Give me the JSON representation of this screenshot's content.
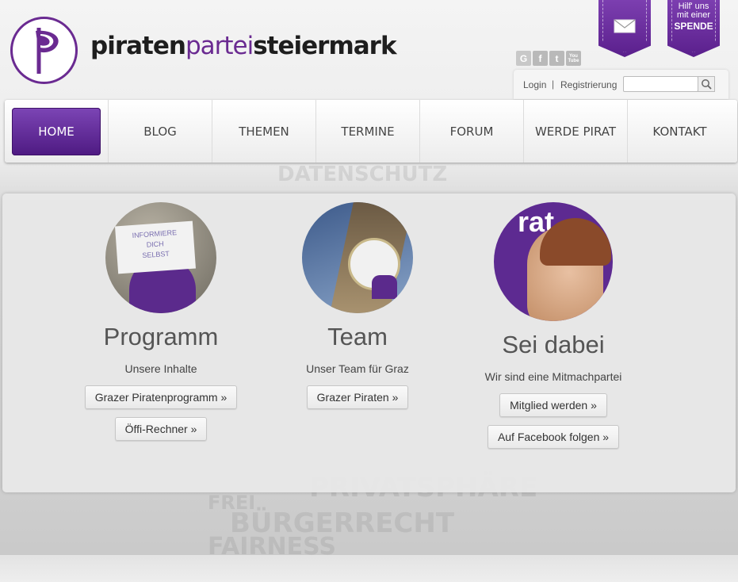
{
  "site": {
    "title_part1": "piraten",
    "title_part2": "partei",
    "title_part3": "steiermark"
  },
  "ribbons": {
    "mail_icon": "envelope-icon",
    "donate_line1": "Hilf' uns",
    "donate_line2": "mit einer",
    "donate_line3": "SPENDE"
  },
  "social": {
    "google": "G",
    "facebook": "f",
    "twitter": "t",
    "youtube": "You Tube"
  },
  "userbar": {
    "login": "Login",
    "separator": "|",
    "register": "Registrierung",
    "search_value": ""
  },
  "nav": {
    "items": [
      {
        "label": "HOME"
      },
      {
        "label": "BLOG"
      },
      {
        "label": "THEMEN"
      },
      {
        "label": "TERMINE"
      },
      {
        "label": "FORUM"
      },
      {
        "label": "WERDE PIRAT"
      },
      {
        "label": "KONTAKT"
      }
    ]
  },
  "columns": [
    {
      "photo_sign": [
        "INFORMIERE",
        "DICH",
        "SELBST"
      ],
      "title": "Programm",
      "subtitle": "Unsere Inhalte",
      "buttons": [
        "Grazer Piratenprogramm »",
        "Öffi-Rechner »"
      ]
    },
    {
      "title": "Team",
      "subtitle": "Unser Team für Graz",
      "buttons": [
        "Grazer Piraten »"
      ]
    },
    {
      "photo_banner": "rat",
      "title": "Sei dabei",
      "subtitle": "Wir sind eine Mitmachpartei",
      "buttons": [
        "Mitglied werden »",
        "Auf Facebook folgen »"
      ]
    }
  ],
  "background_words": [
    "PRIVATSPHÄRE",
    "BÜRGERRECHT",
    "FAIRNESS",
    "DATENSCHUTZ",
    "FREI"
  ],
  "colors": {
    "brand_purple": "#6a2a91",
    "nav_active": "#5d2695"
  }
}
